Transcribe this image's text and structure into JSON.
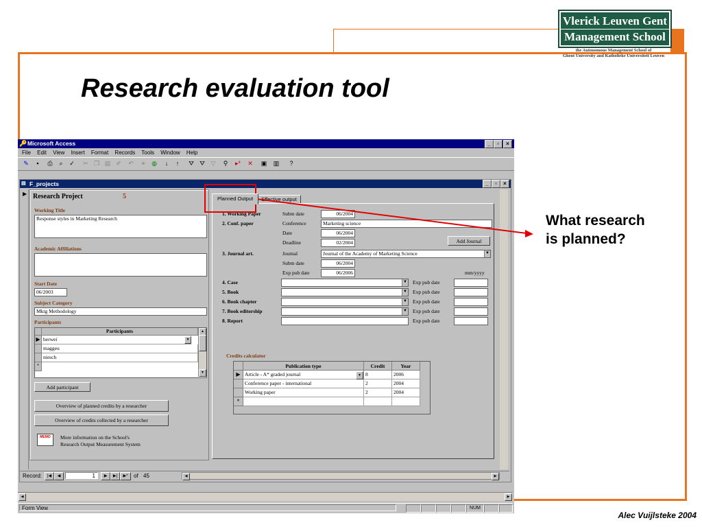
{
  "slide": {
    "title": "Research evaluation tool",
    "callout": "What research is planned?",
    "footer": "Alec Vuijlsteke 2004",
    "logo_line1": "Vlerick Leuven Gent",
    "logo_line2": "Management School",
    "logo_sub1": "the Autonomous Management School of",
    "logo_sub2": "Ghent University and Katholieke Universiteit Leuven",
    "accent_color": "#e8741d",
    "logo_color": "#1f5c45"
  },
  "app": {
    "title": "Microsoft Access",
    "menu": [
      "File",
      "Edit",
      "View",
      "Insert",
      "Format",
      "Records",
      "Tools",
      "Window",
      "Help"
    ],
    "form_title": "F_projects",
    "status_left": "Form View",
    "status_num": "NUM"
  },
  "form": {
    "project_label": "Research Project",
    "project_number": "5",
    "working_title_label": "Working Title",
    "working_title": "Response styles in Marketing Research",
    "affiliations_label": "Academic Affiliations",
    "affiliations": "",
    "start_date_label": "Start Date",
    "start_date": "06/2003",
    "subject_label": "Subject Category",
    "subject": "Mktg Methodology",
    "participants_label": "Participants",
    "participants_header": "Participants",
    "participants": [
      "berwei",
      "maggeu",
      "niesch"
    ],
    "add_participant": "Add participant",
    "btn_planned": "Overview of planned credits by a researcher",
    "btn_collected": "Overview of credits collected by a researcher",
    "memo_icon": "memo-icon",
    "memo_label": "MEMO",
    "info_line1": "More information on the School's",
    "info_line2": "Research Output Measurement System"
  },
  "tabs": {
    "planned": "Planned Output",
    "effective": "Effective output"
  },
  "planned": {
    "wp_label": "1. Working Paper",
    "wp_subm_label": "Subm date",
    "wp_subm": "06/2004",
    "conf_label": "2. Conf. paper",
    "conf_conference_label": "Conference",
    "conf_conference": "Marketing science",
    "conf_date_label": "Date",
    "conf_date": "06/2004",
    "conf_deadline_label": "Deadline",
    "conf_deadline": "02/2004",
    "add_journal": "Add Journal",
    "journal_label": "3. Journal art.",
    "journal_journal_label": "Journal",
    "journal_value": "Journal of the Academy of Marketing Science",
    "journal_subm_label": "Subm date",
    "journal_subm": "06/2004",
    "journal_exp_label": "Exp pub date",
    "journal_exp": "06/2006",
    "format_hint": "mm/yyyy",
    "case_label": "4. Case",
    "book_label": "5. Book",
    "chapter_label": "6. Book chapter",
    "editorship_label": "7. Book editorship",
    "report_label": "8. Report",
    "exp_pub_label": "Exp pub date"
  },
  "credits": {
    "label": "Credits calculator",
    "headers": [
      "Publication type",
      "Credit",
      "Year"
    ],
    "rows": [
      [
        "Article - A* graded journal",
        "8",
        "2006"
      ],
      [
        "Conference paper - international",
        "2",
        "2004"
      ],
      [
        "Working paper",
        "2",
        "2004"
      ]
    ]
  },
  "nav": {
    "record_label": "Record:",
    "record_current": "1",
    "record_of": "of",
    "record_total": "45"
  }
}
